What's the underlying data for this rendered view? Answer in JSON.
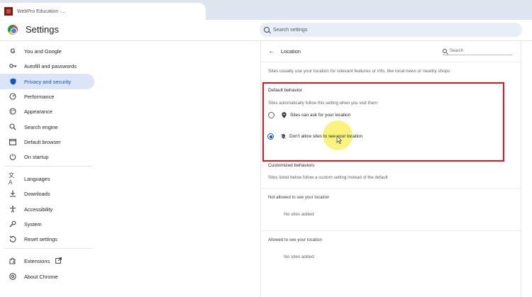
{
  "browser": {
    "tab_title": "WebPro Education -..."
  },
  "header": {
    "app_title": "Settings",
    "search_placeholder": "Search settings"
  },
  "sidebar": {
    "items": [
      {
        "label": "You and Google",
        "icon": "google-icon"
      },
      {
        "label": "Autofill and passwords",
        "icon": "key-icon"
      },
      {
        "label": "Privacy and security",
        "icon": "shield-icon",
        "active": true
      },
      {
        "label": "Performance",
        "icon": "speedometer-icon"
      },
      {
        "label": "Appearance",
        "icon": "palette-icon"
      },
      {
        "label": "Search engine",
        "icon": "search-icon"
      },
      {
        "label": "Default browser",
        "icon": "browser-icon"
      },
      {
        "label": "On startup",
        "icon": "power-icon"
      },
      {
        "label": "Languages",
        "icon": "translate-icon"
      },
      {
        "label": "Downloads",
        "icon": "download-icon"
      },
      {
        "label": "Accessibility",
        "icon": "accessibility-icon"
      },
      {
        "label": "System",
        "icon": "wrench-icon"
      },
      {
        "label": "Reset settings",
        "icon": "reset-icon"
      },
      {
        "label": "Extensions",
        "icon": "puzzle-icon"
      },
      {
        "label": "About Chrome",
        "icon": "chrome-icon"
      }
    ]
  },
  "location": {
    "title": "Location",
    "search_placeholder": "Search",
    "description": "Sites usually use your location for relevant features or info, like local news or nearby shops",
    "default_behavior": {
      "title": "Default behavior",
      "subtitle": "Sites automatically follow this setting when you visit them",
      "options": [
        {
          "label": "Sites can ask for your location",
          "checked": false
        },
        {
          "label": "Don't allow sites to see your location",
          "checked": true
        }
      ]
    },
    "customized": {
      "title": "Customized behaviors",
      "subtitle": "Sites listed below follow a custom setting instead of the default",
      "not_allowed_title": "Not allowed to see your location",
      "not_allowed_empty": "No sites added",
      "allowed_title": "Allowed to see your location",
      "allowed_empty": "No sites added"
    }
  },
  "colors": {
    "accent": "#0b57d0",
    "highlight_box": "#e0141d",
    "active_nav_bg": "#dbe5f7"
  }
}
